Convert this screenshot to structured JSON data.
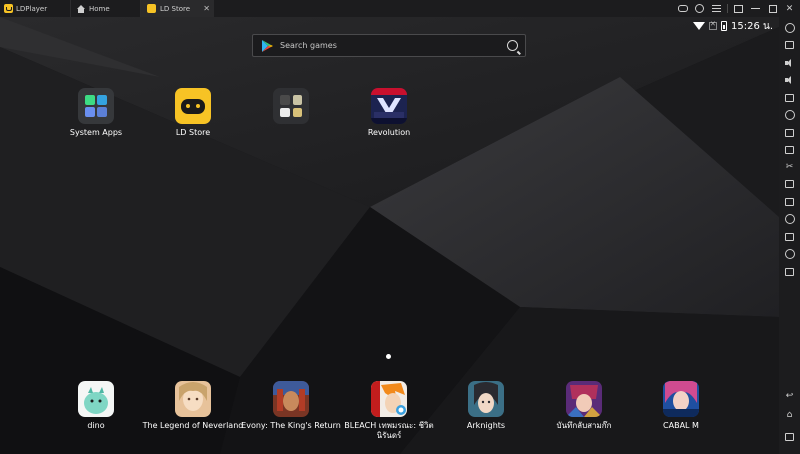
{
  "titlebar": {
    "app_name": "LDPlayer",
    "tabs": [
      {
        "label": "Home",
        "icon": "home-icon"
      },
      {
        "label": "LD Store",
        "icon": "ld-store-icon",
        "close": "✕"
      }
    ],
    "controls": [
      "gamepad-icon",
      "user-icon",
      "menu-icon",
      "picture-in-picture-icon",
      "minimize-icon",
      "maximize-icon",
      "close-icon"
    ]
  },
  "status_bar": {
    "time": "15:26 น."
  },
  "search": {
    "placeholder": "Search games"
  },
  "apps": [
    {
      "label": "System Apps"
    },
    {
      "label": "LD Store"
    },
    {
      "label": ""
    },
    {
      "label": "Revolution"
    }
  ],
  "dock": [
    {
      "label": "dino"
    },
    {
      "label": "The Legend of Neverland"
    },
    {
      "label": "Evony: The King's Return"
    },
    {
      "label": "BLEACH เทพมรณะ: ชีวิตนิรันดร์"
    },
    {
      "label": "Arknights"
    },
    {
      "label": "บันทึกลับสามก๊ก"
    },
    {
      "label": "CABAL M"
    }
  ],
  "sidebar_icons": [
    "settings-icon",
    "keyboard-icon",
    "volume-up-icon",
    "volume-down-icon",
    "fullscreen-icon",
    "sync-icon",
    "add-apk-icon",
    "scissors-icon",
    "record-icon",
    "macro-icon",
    "shake-icon",
    "folder-icon",
    "location-icon",
    "rotate-icon",
    "back-icon",
    "home-icon",
    "recent-apps-icon"
  ],
  "colors": {
    "accent": "#f7c325",
    "titlebar": "#1c1c1e",
    "background": "#121214"
  }
}
